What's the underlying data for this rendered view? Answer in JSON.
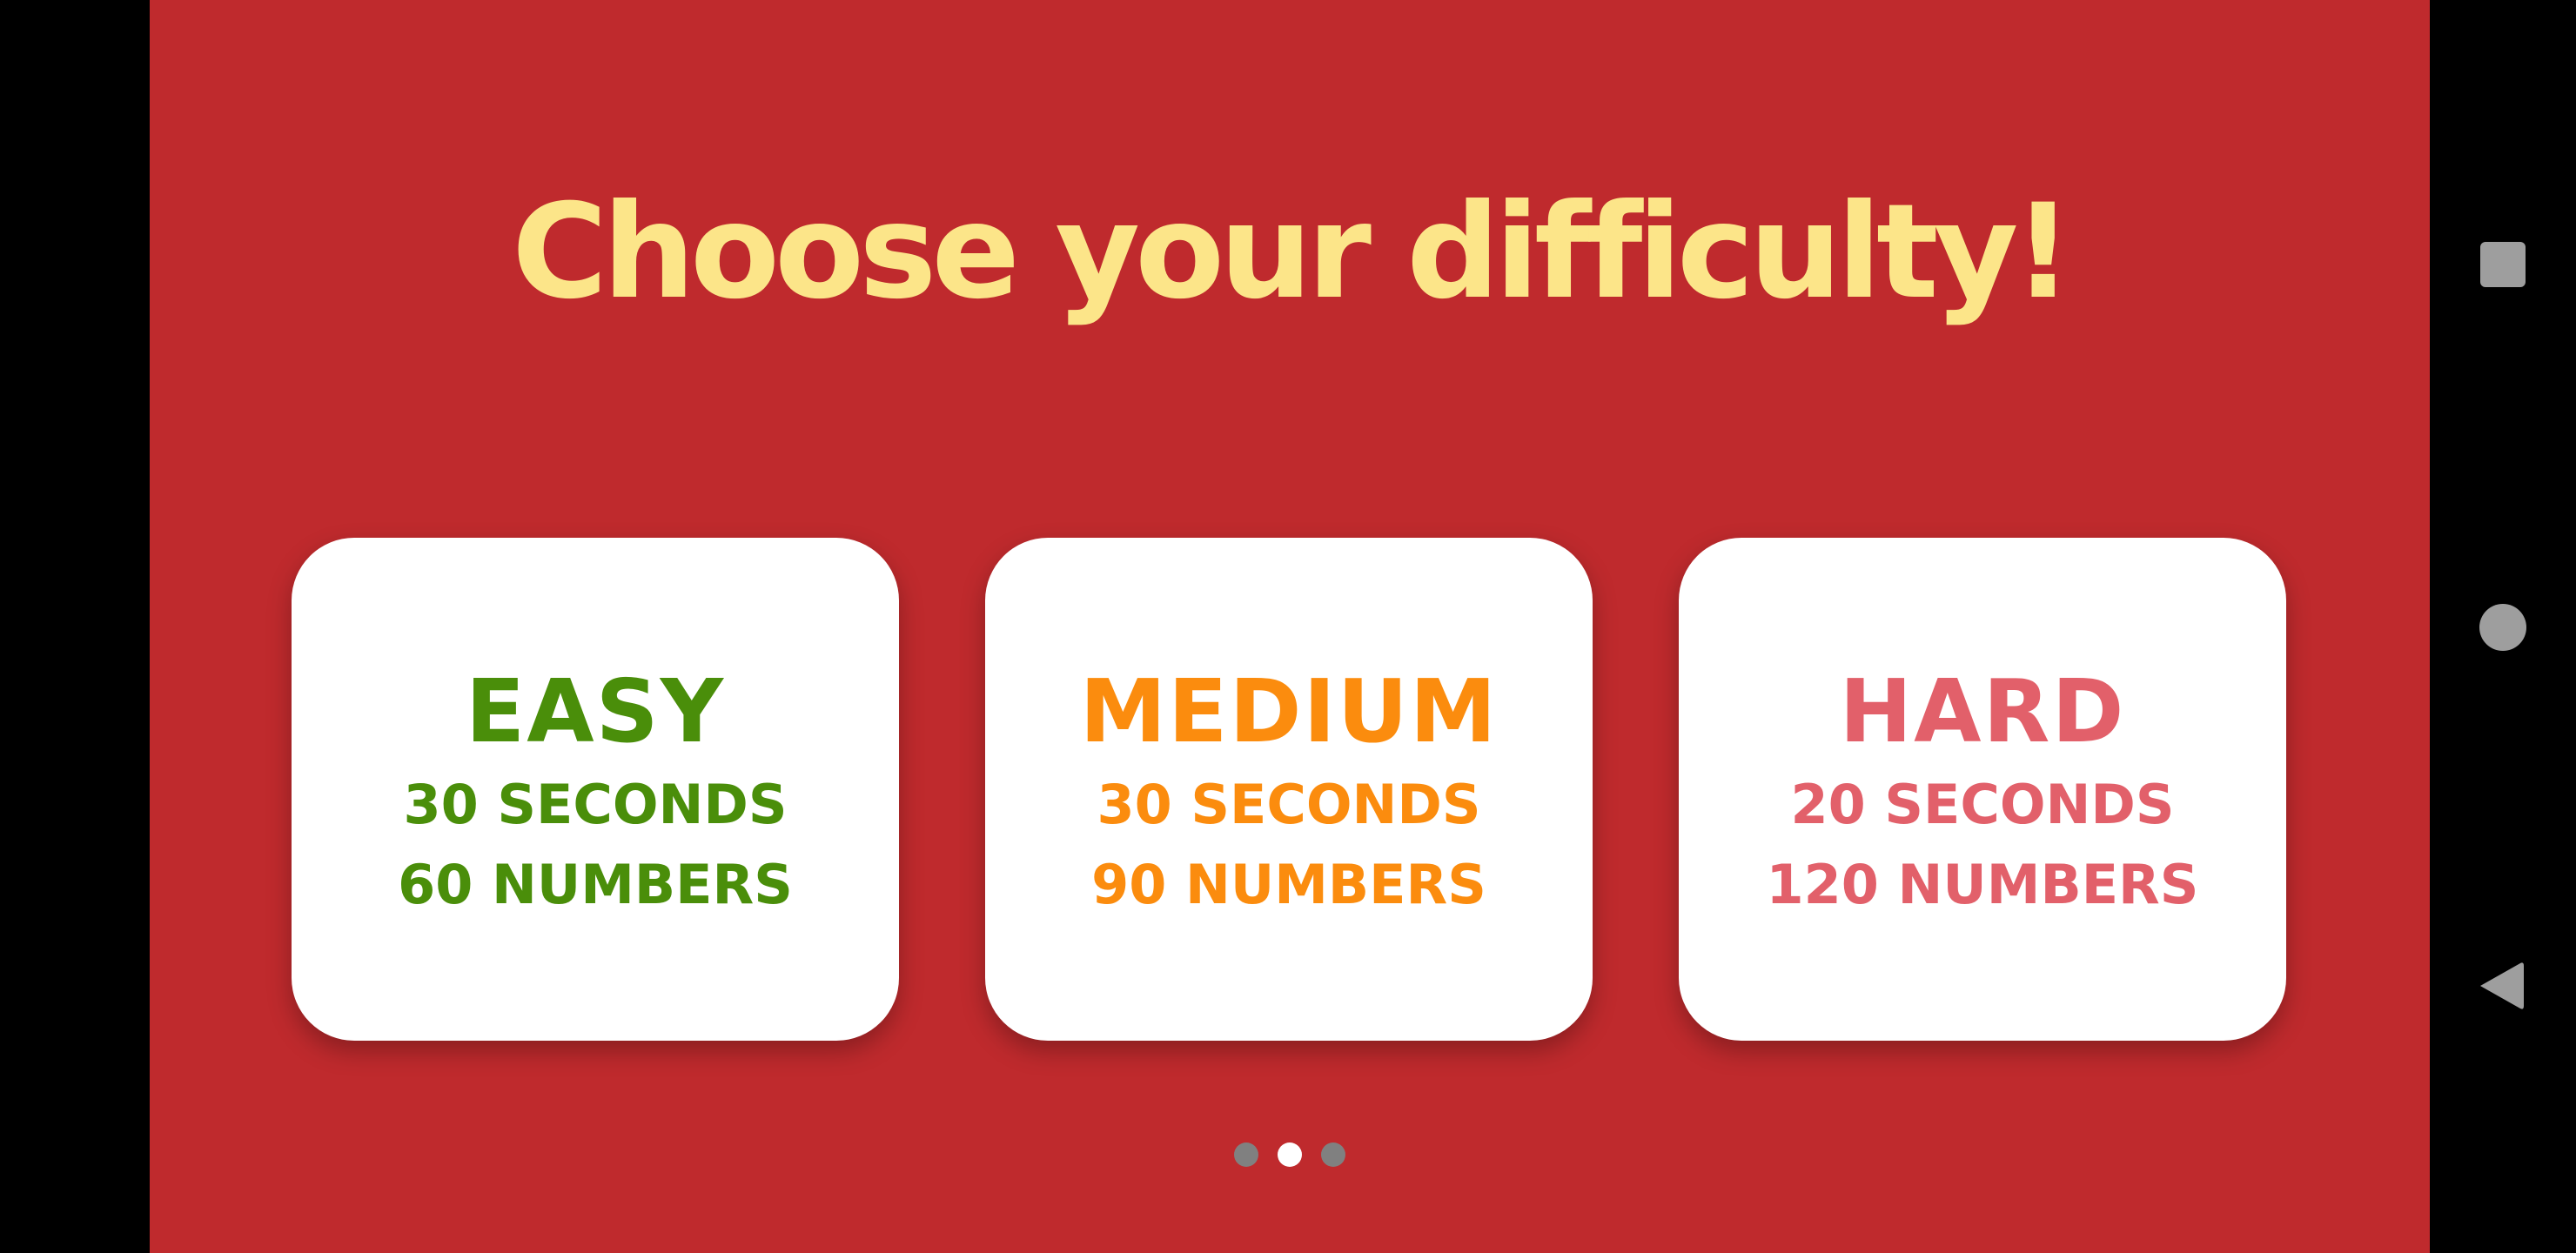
{
  "title": "Choose your difficulty!",
  "colors": {
    "background": "#BF2A2D",
    "title": "#FCE589",
    "card": "#FFFFFF",
    "easy": "#4A8E0A",
    "medium": "#FB8C0E",
    "hard": "#E2606A"
  },
  "cards": [
    {
      "name": "EASY",
      "line1": "30 SECONDS",
      "line2": "60 NUMBERS",
      "color": "#4A8E0A"
    },
    {
      "name": "MEDIUM",
      "line1": "30 SECONDS",
      "line2": "90 NUMBERS",
      "color": "#FB8C0E"
    },
    {
      "name": "HARD",
      "line1": "20 SECONDS",
      "line2": "120 NUMBERS",
      "color": "#E2606A"
    }
  ],
  "pager": {
    "count": 3,
    "active_index": 1
  },
  "nav_icons": [
    "recents-square-icon",
    "home-circle-icon",
    "back-triangle-icon"
  ]
}
